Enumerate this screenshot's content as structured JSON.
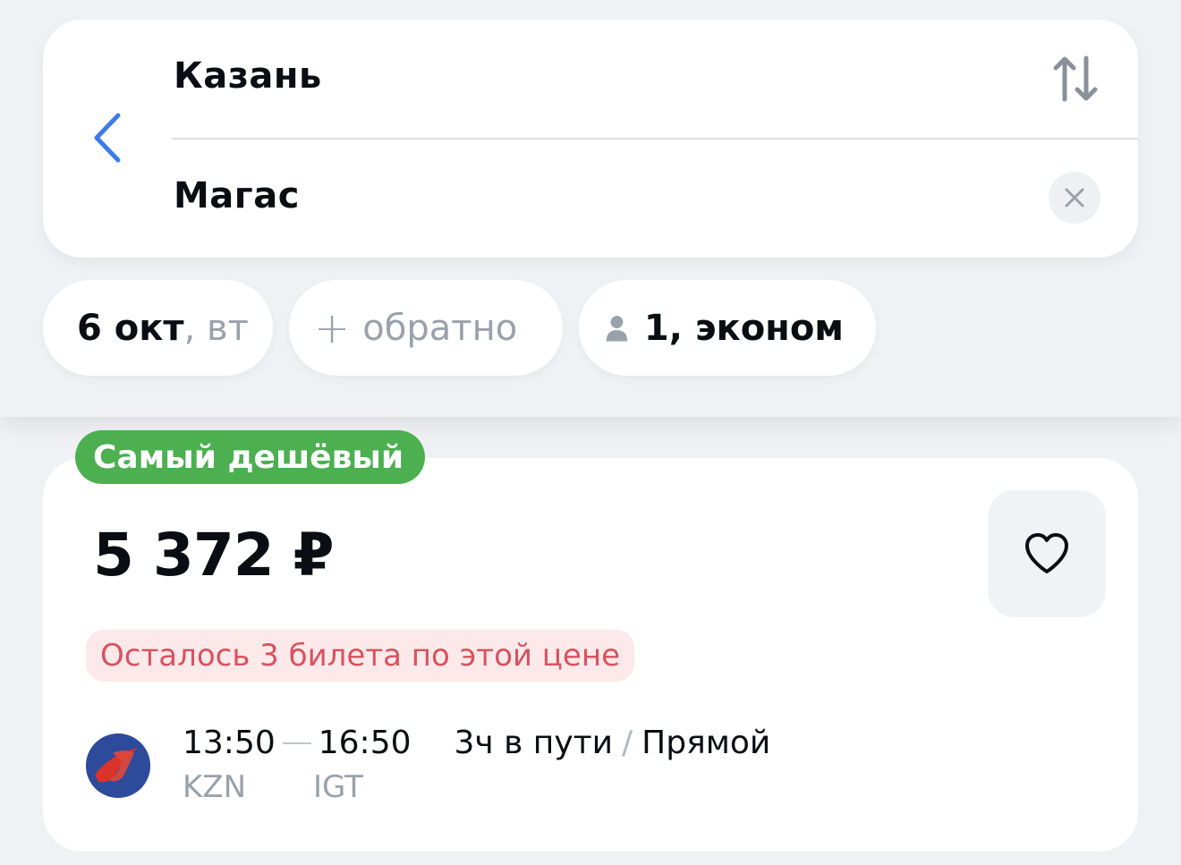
{
  "route": {
    "from_city": "Казань",
    "to_city": "Магас"
  },
  "chips": {
    "date_day": "6 окт",
    "date_weekday": ", вт",
    "return_plus": "+",
    "return_label": "обратно",
    "passengers": "1, эконом"
  },
  "ticket": {
    "badge": "Самый дешёвый",
    "price": "5 372 ₽",
    "seats_left": "Осталось 3 билета по этой цене",
    "departure_time": "13:50",
    "arrival_time": "16:50",
    "duration": "3ч в пути",
    "separator": "/",
    "stops": "Прямой",
    "departure_code": "KZN",
    "arrival_code": "IGT"
  },
  "colors": {
    "accent_blue": "#3d7ce8",
    "badge_green": "#4caf50",
    "warning_red": "#d9525e",
    "warning_bg": "#fde9ea"
  }
}
